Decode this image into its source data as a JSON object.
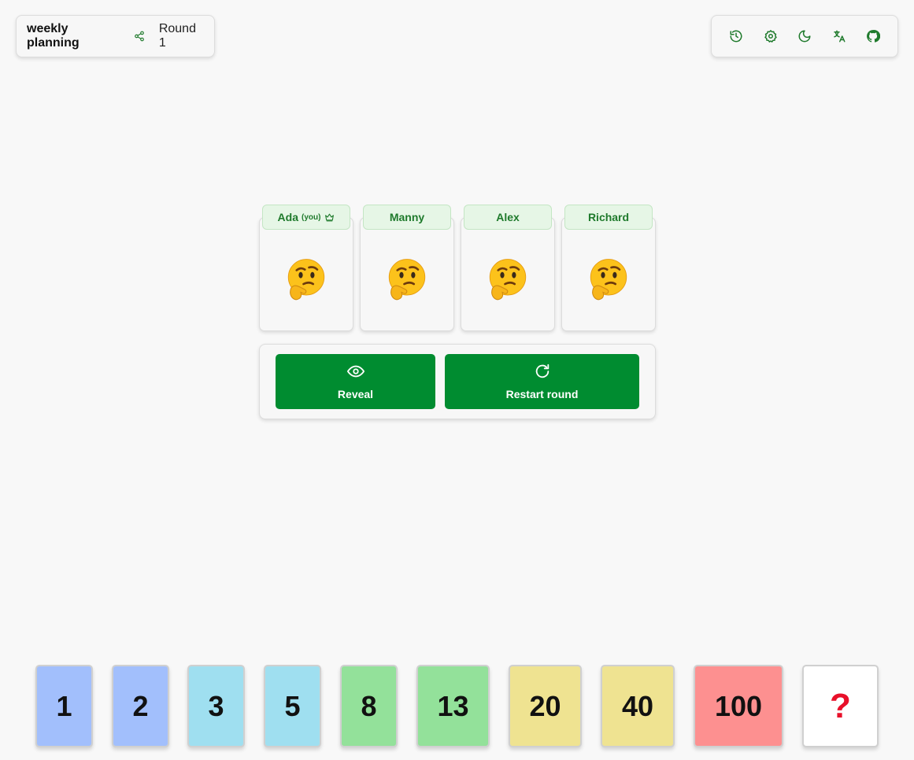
{
  "header": {
    "title": "weekly planning",
    "round": "Round 1"
  },
  "toolbar": {
    "icons": [
      "history-icon",
      "settings-icon",
      "dark-mode-icon",
      "translate-icon",
      "github-icon"
    ]
  },
  "players": [
    {
      "name": "Ada",
      "you_label": "(you)",
      "is_host": true,
      "status": "thinking"
    },
    {
      "name": "Manny",
      "status": "thinking"
    },
    {
      "name": "Alex",
      "status": "thinking"
    },
    {
      "name": "Richard",
      "status": "thinking"
    }
  ],
  "actions": {
    "reveal_label": "Reveal",
    "restart_label": "Restart round"
  },
  "deck": [
    {
      "label": "1",
      "color": "#a2bffc"
    },
    {
      "label": "2",
      "color": "#a2bffc"
    },
    {
      "label": "3",
      "color": "#9fdff0"
    },
    {
      "label": "5",
      "color": "#9fdff0"
    },
    {
      "label": "8",
      "color": "#93e19a"
    },
    {
      "label": "13",
      "color": "#93e19a"
    },
    {
      "label": "20",
      "color": "#efe391"
    },
    {
      "label": "40",
      "color": "#efe391"
    },
    {
      "label": "100",
      "color": "#fd9090"
    },
    {
      "label": "?",
      "color": "#ffffff"
    }
  ],
  "colors": {
    "accent": "#008c30",
    "tag_bg": "#e6f6e6",
    "tag_text": "#1f7a2c"
  }
}
